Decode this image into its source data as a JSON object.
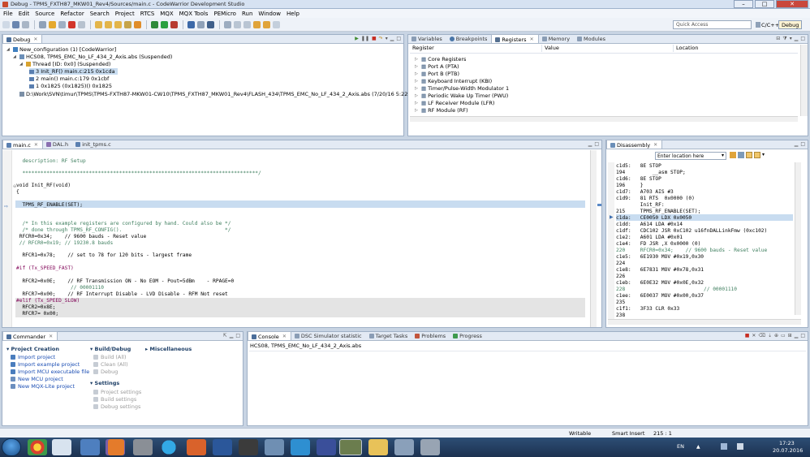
{
  "window": {
    "title": "Debug - TPMS_FXTH87_MKW01_Rev4/Sources/main.c - CodeWarrior Development Studio",
    "minimize": "–",
    "maximize": "□",
    "close": "✕"
  },
  "menu": [
    "File",
    "Edit",
    "Source",
    "Refactor",
    "Search",
    "Project",
    "RTCS",
    "MQX",
    "MQX Tools",
    "PEMicro",
    "Run",
    "Window",
    "Help"
  ],
  "toolbar": {
    "quick_access_placeholder": "Quick Access",
    "perspective_cc": "C/C++",
    "perspective_debug": "Debug"
  },
  "debug_view": {
    "tab": "Debug",
    "rows": [
      "New_configuration (1) [CodeWarrior]",
      "HCS08, TPMS_EMC_No_LF_434_2_Axis.abs (Suspended)",
      "Thread [ID: 0x0] (Suspended)",
      "3 Init_RF() main.c:215 0x1cda",
      "2 main() main.c:179 0x1cbf",
      "1 0x1825 (0x1825)() 0x1825",
      "D:\\Work\\SVN\\timur\\TPMS\\TPMS-FXTH87-MKW01-CW10\\TPMS_FXTH87_MKW01_Rev4\\FLASH_434\\TPMS_EMC_No_LF_434_2_Axis.abs (7/20/16 5:22 PM)"
    ]
  },
  "registers_view": {
    "tabs": [
      "Variables",
      "Breakpoints",
      "Registers",
      "Memory",
      "Modules"
    ],
    "columns": [
      "Register",
      "Value",
      "Location"
    ],
    "rows": [
      "Core Registers",
      "Port A (PTA)",
      "Port B (PTB)",
      "Keyboard Interrupt (KBI)",
      "Timer/Pulse-Width Modulator 1",
      "Periodic Wake Up Timer (PWU)",
      "LF Receiver Module (LFR)",
      "RF Module (RF)"
    ]
  },
  "editor": {
    "tabs": [
      "main.c",
      "DAL.h",
      "init_tpms.c"
    ],
    "lines": [
      "  description: RF Setup",
      "",
      "  ******************************************************************************/",
      "",
      "void Init_RF(void)",
      "{",
      "",
      "  TPMS_RF_ENABLE(SET);",
      "",
      "",
      "  /* In this example registers are configured by hand. Could also be */",
      "  /* done through TPMS_RF_CONFIG().                                  */",
      " RFCR0=0x34;    // 9600 bauds - Reset value",
      " // RFCR0=0x19; // 19230.8 bauds",
      "",
      "  RFCR1=0x78;    // set to 78 for 120 bits - largest frame",
      "",
      "#if (Tx_SPEED_FAST)",
      "",
      "  RFCR2=0x0E;    // RF Transmission ON - No EOM - Pout=5dBm    - RPAGE=0",
      "                  // 00001110",
      "  RFCR7=0x00;    // RF Interrupt Disable - LVD Disable - RFM Not reset",
      "#elif (Tx_SPEED_SLOW)",
      "  RFCR2=0x8E;",
      "  RFCR7= 0x00;"
    ]
  },
  "disassembly": {
    "tab": "Disassembly",
    "location_placeholder": "Enter location here",
    "lines": [
      "c1d5:   8E STOP",
      "194         __asm STOP;",
      "c1d6:   8E STOP",
      "196     }",
      "c1d7:   A703 AIS #3",
      "c1d9:   81 RTS  0x0000 (0)",
      "        Init_RF:",
      "215     TPMS_RF_ENABLE(SET);",
      "c1da:   CE0050 LDX 0x0050",
      "c1dd:   A614 LDA #0x14",
      "c1df:   CDC102 JSR 0xC102 u16fnDALLinkFmw (0xc102)",
      "c1e2:   A601 LDA #0x01",
      "c1e4:   FD JSR ,X 0x0000 (0)",
      "220     RFCR0=0x34;    // 9600 bauds - Reset value",
      "c1e5:   6E1930 MOV #0x19,0x30",
      "224",
      "c1e8:   6E7831 MOV #0x78,0x31",
      "226",
      "c1eb:   6E0E32 MOV #0x0E,0x32",
      "228                          // 00001110",
      "c1ee:   6E0037 MOV #0x00,0x37",
      "235",
      "c1f1:   3F33 CLR 0x33",
      "238"
    ]
  },
  "commander": {
    "tab": "Commander",
    "project_creation": {
      "title": "Project Creation",
      "items": [
        "Import project",
        "Import example project",
        "Import MCU executable file",
        "New MCU project",
        "New MQX-Lite project"
      ]
    },
    "build_debug": {
      "title": "Build/Debug",
      "items": [
        "Build  (All)",
        "Clean  (All)",
        "Debug"
      ]
    },
    "settings": {
      "title": "Settings",
      "items": [
        "Project settings",
        "Build settings",
        "Debug settings"
      ]
    },
    "misc": {
      "title": "Miscellaneous"
    }
  },
  "console": {
    "tabs": [
      "Console",
      "DSC Simulator statistic",
      "Target Tasks",
      "Problems",
      "Progress"
    ],
    "text": "HCS08, TPMS_EMC_No_LF_434_2_Axis.abs"
  },
  "status": {
    "writable": "Writable",
    "insert": "Smart Insert",
    "position": "215 : 1"
  },
  "tray": {
    "lang": "EN",
    "time": "17:23",
    "date": "20.07.2016"
  },
  "colors": {
    "accent": "#3a6ea5",
    "current_line": "#c8dcf0",
    "comment": "#3f7f5f",
    "keyword": "#7f0055"
  }
}
